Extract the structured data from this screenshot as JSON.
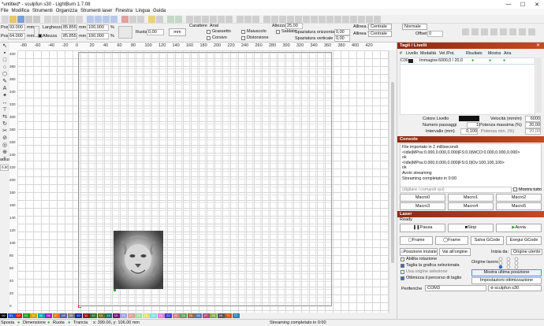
{
  "window": {
    "title": "*untitled* - sculpfun s30 - LightBurn 1.7.08",
    "min": "—",
    "max": "☐",
    "close": "✕"
  },
  "menu": [
    "File",
    "Modifica",
    "Strumenti",
    "Organizza",
    "Strumenti laser",
    "Finestra",
    "Lingua",
    "Guida"
  ],
  "props": {
    "posx_label": "PosX",
    "posx_value": "93.000",
    "posy_label": "PosY",
    "posy_value": "64.000",
    "unit_mm": "mm",
    "width_label": "Larghezza",
    "width_value": "85.855",
    "height_label": "Altezza",
    "height_value": "85.855",
    "pct1": "100,000",
    "pct2": "100,000",
    "pct_sign": "%",
    "rotate_label": "Ruota",
    "rotate_value": "0,00",
    "mm_btn": "mm",
    "font_label": "Carattere",
    "font_value": "Arial",
    "bold_label": "Grassetto",
    "italic_label": "Corsivo",
    "upper_label": "Maiuscolo",
    "distort_label": "Distorsione",
    "welded_label": "Saldato",
    "textheight_label": "Altezza",
    "textheight_value": "25,00",
    "hspace_label": "Spaziatura orizzontale",
    "hspace_value": "0,00",
    "vspace_label": "Spaziatura verticale",
    "vspace_value": "0,00",
    "alignx_label": "Allinea X",
    "alignx_value": "Centrale",
    "aligny_label": "Allinea Y",
    "aligny_value": "Centrale",
    "normal_value": "Normale",
    "offset_label": "Offset",
    "offset_value": "0"
  },
  "ruler": {
    "top": [
      "-80",
      "-60",
      "-40",
      "-20",
      "0",
      "20",
      "40",
      "60",
      "80",
      "100",
      "120",
      "140",
      "160",
      "180",
      "200",
      "220",
      "240",
      "260",
      "280",
      "300",
      "320",
      "340",
      "360",
      "380",
      "400",
      "420"
    ],
    "left": [
      "400",
      "380",
      "360",
      "340",
      "320",
      "300",
      "280",
      "260",
      "240",
      "220",
      "200",
      "180",
      "160",
      "140",
      "120",
      "100",
      "80",
      "60",
      "40",
      "20",
      "0"
    ],
    "radius_label": "adius:",
    "radius_value": "0,00"
  },
  "layers_panel": {
    "title": "Tagli / Livelli",
    "headers": [
      "#",
      "Livello",
      "Modalità",
      "Vel./Pot.",
      "Risultato",
      "Mostra",
      "Aria"
    ],
    "row": {
      "num": "C00",
      "mode": "Immagine",
      "speed_power": "6000,0 / 20,0"
    },
    "color_label": "Colore Livello",
    "speed_label": "Velocità (mm/m)",
    "speed_value": "6000",
    "passes_label": "Numero passaggi",
    "passes_value": "1",
    "maxpower_label": "Potenza massima (%)",
    "maxpower_value": "20,00",
    "interval_label": "Intervallo (mm)",
    "interval_value": "0,100",
    "minpower_label": "Potenza min. (%)",
    "minpower_value": "20,00"
  },
  "console": {
    "title": "Console",
    "lines": [
      "File importato in 2 millisecondi",
      "<Idle|MPos:0.000,0.000,0.000|FS:0,0|WCO:0.000,0.000,0.000>",
      "ok",
      "<Idle|MPos:0.000,0.000,0.000|FS:0,0|Ov:100,100,100>",
      "ok",
      "Avvio streaming",
      "Streaming completato in 0:00"
    ],
    "placeholder": "(digitare i comandi qui)",
    "show_all": "Mostra tutto",
    "macros": [
      "Macro0",
      "Macro1",
      "Macro2",
      "Macro3",
      "Macro4",
      "Macro5"
    ]
  },
  "laser_panel": {
    "title": "Laser",
    "status": "Ready",
    "pause": "Pausa",
    "stop": "Stop",
    "start": "Avvia",
    "frame1": "Frame",
    "frame2": "Frame",
    "save_gcode": "Salva GCode",
    "run_gcode": "Esegui GCode",
    "home_pos": "Posizione iniziale",
    "goto_origin": "Vai all'origine",
    "start_from_label": "Inizia da:",
    "start_from_value": "Origine utente",
    "rotary_label": "Abilita rotazione",
    "cut_selected_label": "Taglia la grafica selezionata",
    "use_selection_origin_label": "Usa origine selezione",
    "optimize_label": "Ottimizza il percorso di taglio",
    "job_origin_label": "Origine lavoro",
    "show_last_pos": "Mostra ultima posizione",
    "optimize_settings": "Impostazioni ottimizzazione",
    "devices_label": "Periferiche",
    "port_value": "COM3",
    "device_value": "sculpfun s30"
  },
  "palette": [
    "00",
    "01",
    "02",
    "03",
    "04",
    "05",
    "06",
    "07",
    "08",
    "09",
    "10",
    "11",
    "12",
    "13",
    "14",
    "15",
    "16",
    "17",
    "18",
    "19",
    "20",
    "21",
    "22",
    "23",
    "24",
    "25",
    "26",
    "27",
    "28",
    "29",
    "T1",
    "T2"
  ],
  "palette_colors": [
    "#000000",
    "#1f4fd6",
    "#d01c1c",
    "#1d9a23",
    "#c7a500",
    "#0aa7a7",
    "#a517c4",
    "#e07a00",
    "#5a5aa8",
    "#7a7a7a",
    "#0e2e8e",
    "#8e1717",
    "#2e6e2e",
    "#6e6e1a",
    "#1a6e6e",
    "#6e1a6e",
    "#a0a0e0",
    "#e0a0a0",
    "#a0e0a0",
    "#e0e080",
    "#80e0e0",
    "#e080e0",
    "#3a3ad0",
    "#d08080",
    "#60a060",
    "#9b6a3a",
    "#4a7ab0",
    "#b04a7a",
    "#7ab04a",
    "#555555",
    "#d35400",
    "#2980b9"
  ],
  "status": {
    "move": "Sposta",
    "size": "Dimensione",
    "rotate": "Ruota",
    "shear": "Trancia",
    "coords": "x: 399.00, y: 106.00 mm",
    "message": "Streaming completato in 0:00"
  }
}
